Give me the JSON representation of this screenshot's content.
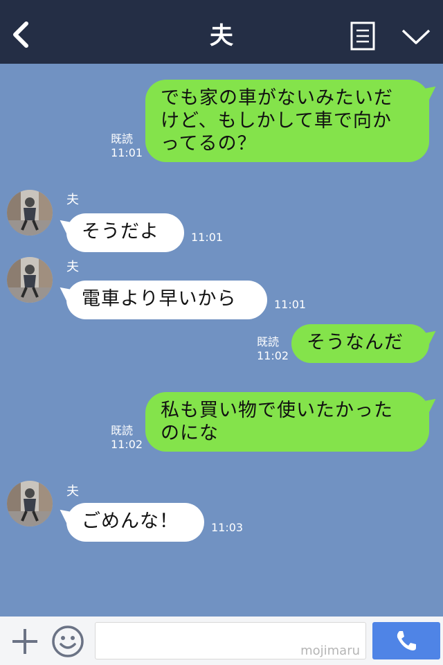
{
  "header": {
    "title": "夫",
    "back_icon": "chevron-left-icon",
    "notes_icon": "notes-icon",
    "menu_icon": "chevron-down-icon"
  },
  "messages": [
    {
      "side": "out",
      "text": "でも家の車がないみたいだ\nけど、もしかして車で向か\nってるの？",
      "read": "既読",
      "time": "11:01"
    },
    {
      "side": "in",
      "sender": "夫",
      "text": "そうだよ",
      "time": "11:01"
    },
    {
      "side": "in",
      "sender": "夫",
      "text": "電車より早いから",
      "time": "11:01"
    },
    {
      "side": "out",
      "text": "そうなんだ",
      "read": "既読",
      "time": "11:02"
    },
    {
      "side": "out",
      "text": "私も買い物で使いたかった\nのにな",
      "read": "既読",
      "time": "11:02"
    },
    {
      "side": "in",
      "sender": "夫",
      "text": "ごめんな！",
      "time": "11:03"
    }
  ],
  "footer": {
    "input_value": "",
    "watermark": "mojimaru"
  },
  "colors": {
    "header_bg": "#242e45",
    "chat_bg": "#7192c2",
    "outgoing_bubble": "#84e34b",
    "incoming_bubble": "#ffffff",
    "call_button": "#4f84e6"
  }
}
